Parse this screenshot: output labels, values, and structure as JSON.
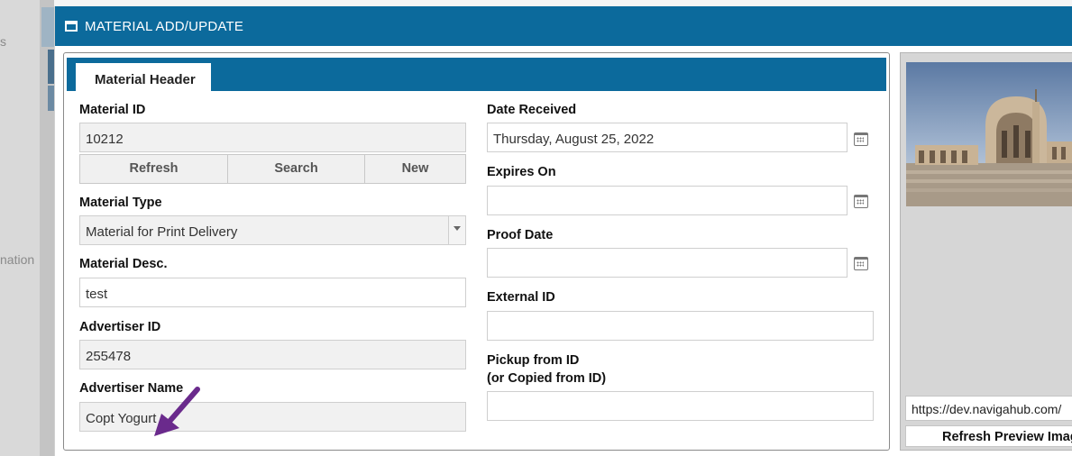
{
  "background_app": {
    "fragment_top": "s",
    "fragment_mid": "nation"
  },
  "dialog": {
    "title": "MATERIAL ADD/UPDATE",
    "tab_label": "Material Header",
    "material_id": {
      "label": "Material ID",
      "value": "10212"
    },
    "buttons": {
      "refresh": "Refresh",
      "search": "Search",
      "new": "New"
    },
    "material_type": {
      "label": "Material Type",
      "value": "Material for Print Delivery"
    },
    "material_desc": {
      "label": "Material Desc.",
      "value": "test"
    },
    "advertiser_id": {
      "label": "Advertiser ID",
      "value": "255478"
    },
    "advertiser_name": {
      "label": "Advertiser Name",
      "value": "Copt Yogurt"
    },
    "date_received": {
      "label": "Date Received",
      "value": "Thursday, August 25, 2022"
    },
    "expires_on": {
      "label": "Expires On",
      "value": ""
    },
    "proof_date": {
      "label": "Proof Date",
      "value": ""
    },
    "external_id": {
      "label": "External ID",
      "value": ""
    },
    "pickup_from_id": {
      "label_line1": "Pickup from ID",
      "label_line2": "(or Copied from ID)",
      "value": ""
    }
  },
  "preview": {
    "url": "https://dev.navigahub.com/",
    "refresh_label": "Refresh Preview Image"
  },
  "colors": {
    "accent": "#0c6a9c",
    "annotation_arrow": "#6a2a8c"
  },
  "icons": [
    "window-icon",
    "calendar-icon",
    "dropdown-arrow-icon"
  ]
}
